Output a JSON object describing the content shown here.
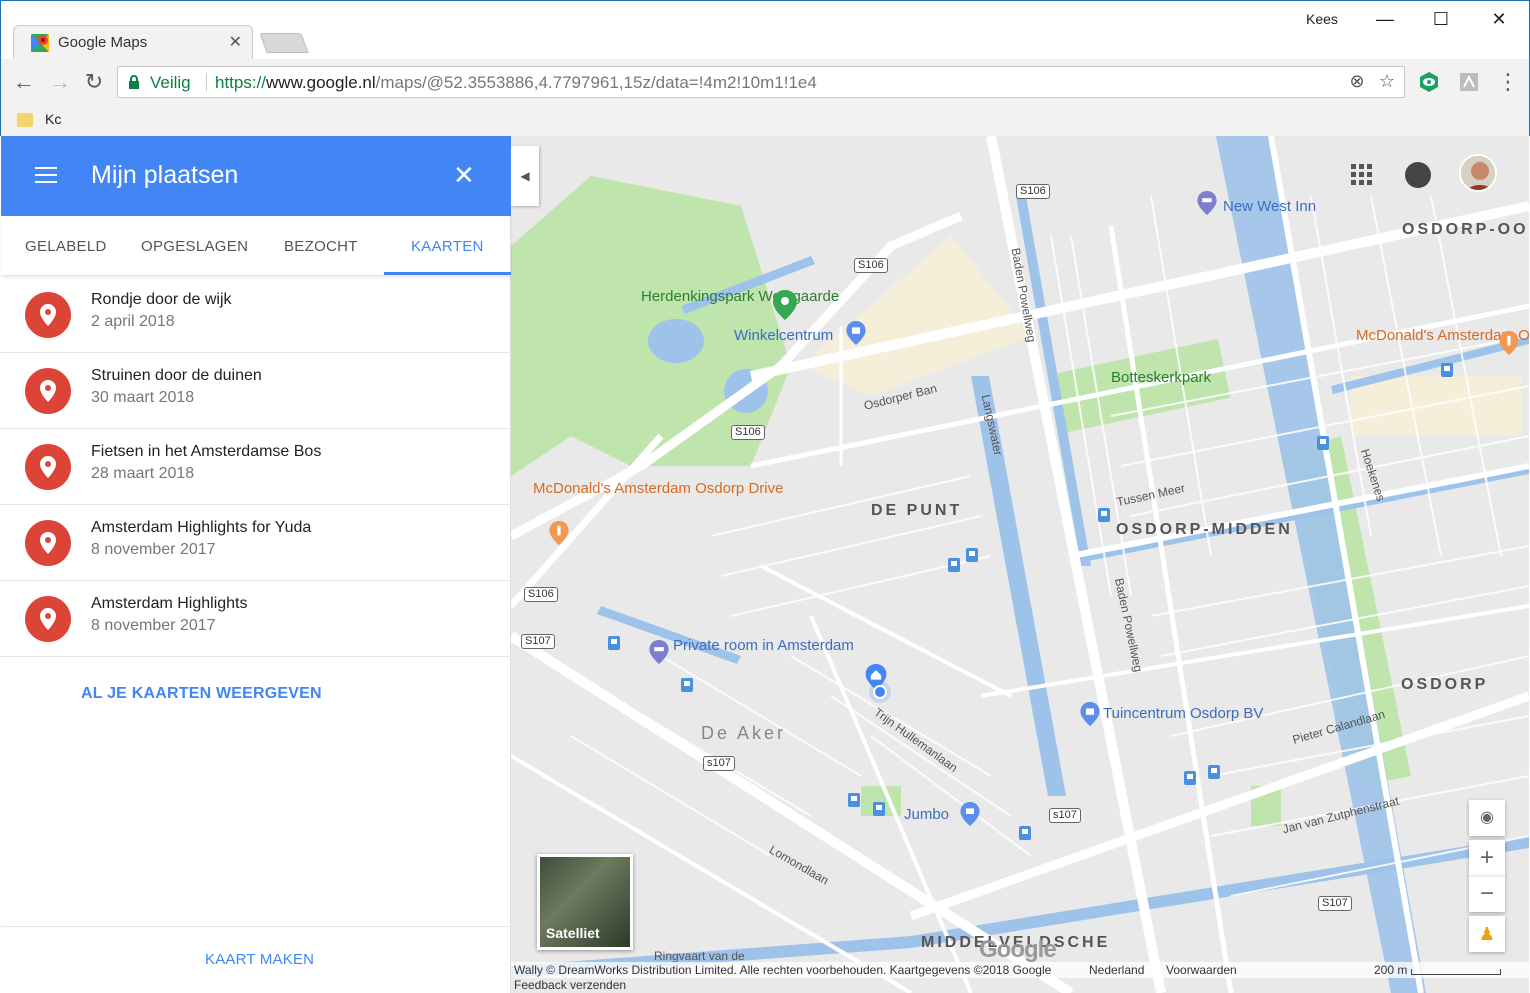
{
  "browser": {
    "tab_title": "Google Maps",
    "user_name": "Kees",
    "security_label": "Veilig",
    "url_protocol": "https://",
    "url_host": "www.google.nl",
    "url_path": "/maps/@52.3553886,4.7797961,15z/data=!4m2!10m1!1e4",
    "bookmark_label": "Kc"
  },
  "panel": {
    "title": "Mijn plaatsen",
    "tabs": [
      {
        "label": "GELABELD"
      },
      {
        "label": "OPGESLAGEN"
      },
      {
        "label": "BEZOCHT"
      },
      {
        "label": "KAARTEN"
      }
    ],
    "active_tab": "KAARTEN",
    "maps": [
      {
        "title": "Rondje door de wijk",
        "date": "2 april 2018"
      },
      {
        "title": "Struinen door de duinen",
        "date": "30 maart 2018"
      },
      {
        "title": "Fietsen in het Amsterdamse Bos",
        "date": "28 maart 2018"
      },
      {
        "title": "Amsterdam Highlights for Yuda",
        "date": "8 november 2017"
      },
      {
        "title": "Amsterdam Highlights",
        "date": "8 november 2017"
      }
    ],
    "show_all_label": "AL JE KAARTEN WEERGEVEN",
    "make_map_label": "KAART MAKEN"
  },
  "map": {
    "places": {
      "park": "Herdenkingspark Westgaarde",
      "mall": "Winkelcentrum",
      "hotel": "New West Inn",
      "mcd_osdorp": "McDonald's Amsterdam Osdorp",
      "mcd_drive": "McDonald's Amsterdam Osdorp Drive",
      "botteskerkpark": "Botteskerkpark",
      "private_room": "Private room in Amsterdam",
      "tuincentrum": "Tuincentrum Osdorp BV",
      "jumbo": "Jumbo"
    },
    "districts": {
      "de_punt": "DE PUNT",
      "osdorp_midden": "OSDORP-MIDDEN",
      "osdorp": "OSDORP",
      "osdorp_oost": "OSDORP-OOS",
      "de_aker": "De Aker",
      "middelveldsche": "MIDDELVELDSCHE"
    },
    "streets": {
      "osdorper_ban": "Osdorper Ban",
      "baden_powellweg": "Baden Powellweg",
      "pieter_calandlaan": "Pieter Calandlaan",
      "hoekenes": "Hoekenes",
      "langswater": "Langswater",
      "tussen_meer": "Tussen Meer",
      "lomondlaan": "Lomondlaan",
      "trijn_hullemanlaan": "Trijn Hullemanlaan",
      "jan_van_zutphenstraat": "Jan van Zutphenstraat",
      "ringvaart": "Ringvaart van de"
    },
    "road_shields": [
      "S106",
      "S106",
      "S106",
      "S106",
      "S107",
      "s107",
      "s107",
      "S107"
    ],
    "satellite_label": "Satelliet",
    "attribution": "Wally © DreamWorks Distribution Limited. Alle rechten voorbehouden. Kaartgegevens ©2018 Google",
    "attribution_country": "Nederland",
    "attribution_terms": "Voorwaarden",
    "scale_label": "200 m",
    "feedback_label": "Feedback verzenden",
    "google_wordmark": "Google"
  },
  "colors": {
    "header_blue": "#4285f4",
    "pin_red": "#db4437",
    "secure_green": "#0b8043",
    "water": "#9ec3ea",
    "park": "#b7e0a5"
  }
}
